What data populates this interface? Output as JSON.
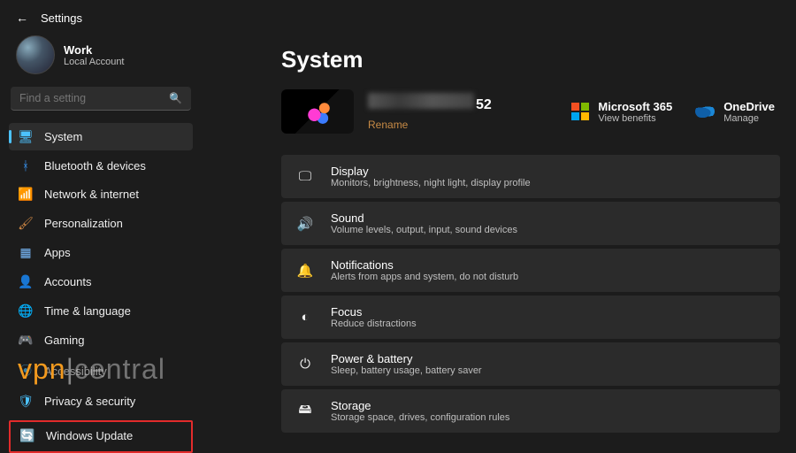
{
  "header": {
    "title": "Settings"
  },
  "profile": {
    "name": "Work",
    "sub": "Local Account"
  },
  "search": {
    "placeholder": "Find a setting"
  },
  "sidebar": {
    "items": [
      {
        "label": "System",
        "icon": "🖥",
        "active": true
      },
      {
        "label": "Bluetooth & devices",
        "icon": "ᚼ"
      },
      {
        "label": "Network & internet",
        "icon": "📶"
      },
      {
        "label": "Personalization",
        "icon": "🖌"
      },
      {
        "label": "Apps",
        "icon": "▦"
      },
      {
        "label": "Accounts",
        "icon": "👤"
      },
      {
        "label": "Time & language",
        "icon": "🌐"
      },
      {
        "label": "Gaming",
        "icon": "🎮"
      },
      {
        "label": "Accessibility",
        "icon": "⦿"
      },
      {
        "label": "Privacy & security",
        "icon": "🛡"
      },
      {
        "label": "Windows Update",
        "icon": "🔄"
      }
    ]
  },
  "page": {
    "title": "System",
    "device_suffix": "52",
    "rename": "Rename",
    "ms365": {
      "title": "Microsoft 365",
      "sub": "View benefits"
    },
    "onedrive": {
      "title": "OneDrive",
      "sub": "Manage"
    },
    "cards": [
      {
        "icon": "🖵",
        "title": "Display",
        "sub": "Monitors, brightness, night light, display profile"
      },
      {
        "icon": "🔊",
        "title": "Sound",
        "sub": "Volume levels, output, input, sound devices"
      },
      {
        "icon": "🔔",
        "title": "Notifications",
        "sub": "Alerts from apps and system, do not disturb"
      },
      {
        "icon": "◐",
        "title": "Focus",
        "sub": "Reduce distractions"
      },
      {
        "icon": "⏻",
        "title": "Power & battery",
        "sub": "Sleep, battery usage, battery saver"
      },
      {
        "icon": "🖴",
        "title": "Storage",
        "sub": "Storage space, drives, configuration rules"
      }
    ]
  },
  "watermark": {
    "vpn": "vpn",
    "rest": "central"
  }
}
